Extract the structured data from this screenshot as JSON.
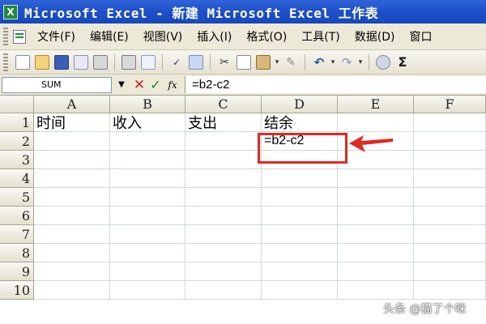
{
  "window": {
    "title": "Microsoft Excel - 新建 Microsoft Excel 工作表",
    "app_icon": "excel-icon"
  },
  "menubar": {
    "items": [
      {
        "label": "文件(F)"
      },
      {
        "label": "编辑(E)"
      },
      {
        "label": "视图(V)"
      },
      {
        "label": "插入(I)"
      },
      {
        "label": "格式(O)"
      },
      {
        "label": "工具(T)"
      },
      {
        "label": "数据(D)"
      },
      {
        "label": "窗口"
      }
    ]
  },
  "toolbar": {
    "icons": [
      "new-icon",
      "open-icon",
      "save-icon",
      "permission-icon",
      "print-icon",
      "print-preview-icon",
      "spelling-icon",
      "research-icon",
      "cut-icon",
      "copy-icon",
      "paste-icon",
      "format-painter-icon",
      "undo-icon",
      "redo-icon",
      "hyperlink-icon",
      "autosum-icon"
    ]
  },
  "formula_bar": {
    "name_box": "SUM",
    "fx_label": "fx",
    "formula": "=b2-c2"
  },
  "sheet": {
    "columns": [
      "A",
      "B",
      "C",
      "D",
      "E",
      "F"
    ],
    "rows": [
      "1",
      "2",
      "3",
      "4",
      "5",
      "6",
      "7",
      "8",
      "9",
      "10"
    ],
    "cells": {
      "A1": "时间",
      "B1": "收入",
      "C1": "支出",
      "D1": "结余",
      "D2": "=b2-c2"
    },
    "active_cell": "D2"
  },
  "annotation": {
    "highlight_color": "#e32822"
  },
  "watermark": "头条 @猫了个咪",
  "colors": {
    "titlebar": "#1c4fc8",
    "menubar_bg": "#ece9d8",
    "gridline": "#d0d7e5"
  }
}
